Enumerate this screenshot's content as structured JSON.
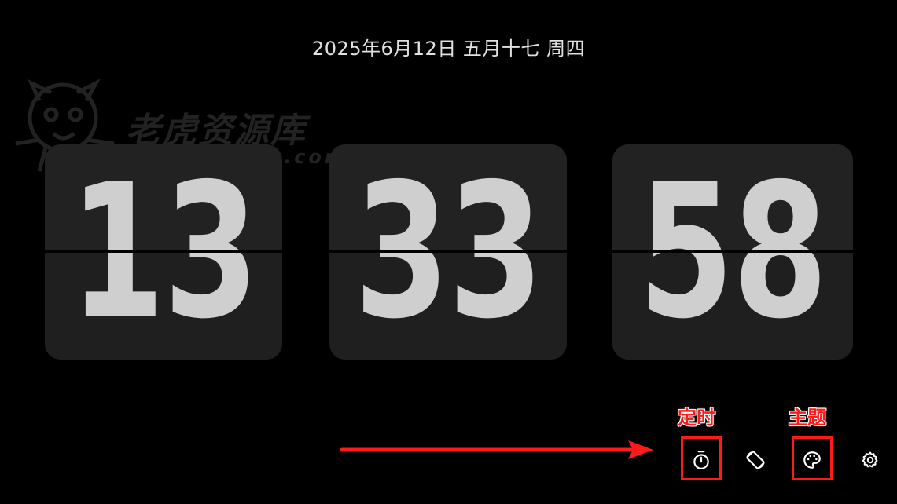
{
  "date_line": "2025年6月12日 五月十七 周四",
  "watermark": {
    "title": "老虎资源库",
    "url": "www.lhzyk.com"
  },
  "clock": {
    "hours": "13",
    "minutes": "33",
    "seconds": "58"
  },
  "annotations": {
    "timer_label": "定时",
    "theme_label": "主题",
    "accent_color": "#ff1a1a"
  },
  "toolbar": {
    "buttons": [
      {
        "icon": "stopwatch-icon"
      },
      {
        "icon": "screen-rotation-icon"
      },
      {
        "icon": "palette-icon"
      },
      {
        "icon": "gear-icon"
      }
    ]
  },
  "colors": {
    "background": "#000000",
    "card": "#222222",
    "digit": "#cfcfcf",
    "date_text": "#e0e0e0"
  }
}
